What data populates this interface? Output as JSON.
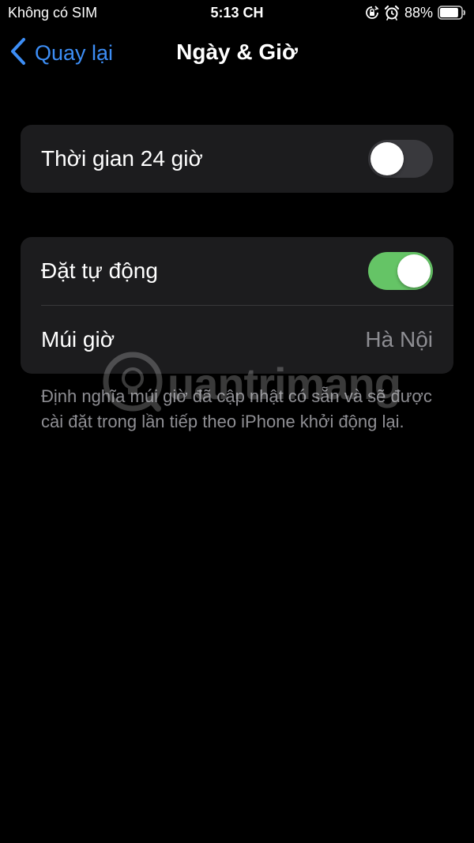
{
  "status_bar": {
    "carrier": "Không có SIM",
    "time": "5:13 CH",
    "battery_percent": "88%",
    "battery_level": 0.88,
    "icons": [
      "orientation-lock-icon",
      "alarm-icon",
      "battery-icon"
    ]
  },
  "nav": {
    "back_label": "Quay lại",
    "title": "Ngày & Giờ"
  },
  "settings": {
    "time_24h": {
      "label": "Thời gian 24 giờ",
      "enabled": false
    },
    "set_automatically": {
      "label": "Đặt tự động",
      "enabled": true
    },
    "time_zone": {
      "label": "Múi giờ",
      "value": "Hà Nội"
    },
    "footer_note": "Định nghĩa múi giờ đã cập nhật có sẵn và sẽ được cài đặt trong lần tiếp theo iPhone khởi động lại."
  },
  "watermark": {
    "text": "uantrimang"
  },
  "colors": {
    "background": "#000000",
    "group_background": "#1c1c1e",
    "accent_blue": "#3d8ef6",
    "toggle_on": "#65c466",
    "toggle_off": "#39393d",
    "secondary_text": "#8e8e93"
  }
}
